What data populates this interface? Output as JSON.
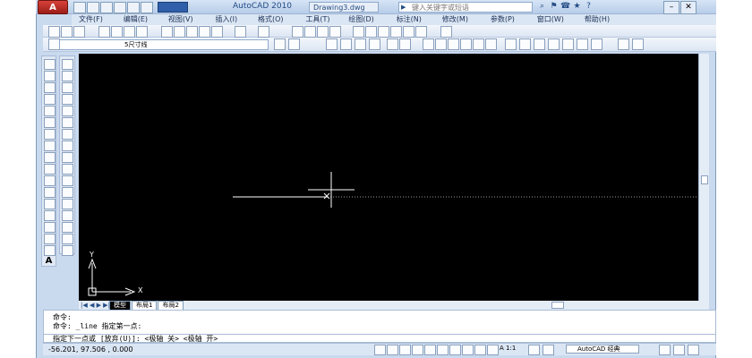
{
  "app": {
    "title": "AutoCAD 2010",
    "filename": "Drawing3.dwg",
    "logo": "A",
    "search_placeholder": "键入关键字或短语"
  },
  "menus": [
    {
      "label": "文件(F)"
    },
    {
      "label": "编辑(E)"
    },
    {
      "label": "视图(V)"
    },
    {
      "label": "插入(I)"
    },
    {
      "label": "格式(O)"
    },
    {
      "label": "工具(T)"
    },
    {
      "label": "绘图(D)"
    },
    {
      "label": "标注(N)"
    },
    {
      "label": "修改(M)"
    },
    {
      "label": "参数(P)"
    },
    {
      "label": "窗口(W)"
    },
    {
      "label": "帮助(H)"
    }
  ],
  "layer": {
    "current": "5尺寸线"
  },
  "tabs": [
    {
      "label": "模型",
      "active": true
    },
    {
      "label": "布局1",
      "active": false
    },
    {
      "label": "布局2",
      "active": false
    }
  ],
  "ucs": {
    "x_label": "X",
    "y_label": "Y"
  },
  "command": {
    "history": [
      "命令:",
      "命令: _line 指定第一点:"
    ],
    "prompt": "指定下一点或 [放弃(U)]: <极轴 关> <极轴 开>"
  },
  "status": {
    "coords": "-56.201, 97.506 , 0.000",
    "scale": "A 1:1",
    "workspace": "AutoCAD 经典"
  },
  "colors": {
    "canvas": "#000000",
    "crosshair": "#ffffff",
    "accent": "#2f5fa8"
  }
}
